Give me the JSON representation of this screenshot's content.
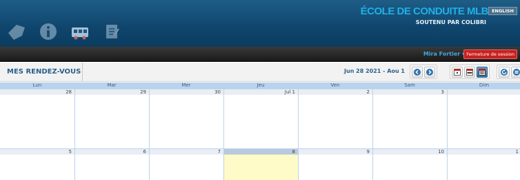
{
  "header": {
    "brand_title": "ÉCOLE DE CONDUITE MLB",
    "brand_subtitle": "SOUTENU PAR COLIBRI",
    "language_button": "ENGLISH",
    "nav_icons": [
      "tag-icon",
      "info-icon",
      "bus-icon",
      "document-icon"
    ]
  },
  "userbar": {
    "user_name": "Mira Fortier ▾",
    "logout_label": "Fermeture de session"
  },
  "toolbar": {
    "page_title": "MES RENDEZ-VOUS",
    "date_range": "Jun 28 2021 - Aou 1",
    "nav_buttons": [
      "prev-icon",
      "next-icon"
    ],
    "view_buttons": [
      "day-view-icon",
      "week-view-icon",
      "month-view-icon"
    ],
    "extra_buttons": [
      "refresh-icon",
      "list-icon"
    ]
  },
  "calendar": {
    "weekdays": [
      "Lun",
      "Mar",
      "Mer",
      "Jeu",
      "Ven",
      "Sam",
      "Dim"
    ],
    "weeks": [
      {
        "days": [
          "28",
          "29",
          "30",
          "Jul 1",
          "2",
          "3",
          ""
        ]
      },
      {
        "days": [
          "5",
          "6",
          "7",
          "8",
          "9",
          "10",
          "1"
        ]
      }
    ],
    "today": "8"
  },
  "colors": {
    "header_bg": "#0f456d",
    "brand_accent": "#1fb0e6",
    "logout_red": "#c82020",
    "today_bg": "#fffbc9",
    "grid_line": "#b9d3ec"
  }
}
